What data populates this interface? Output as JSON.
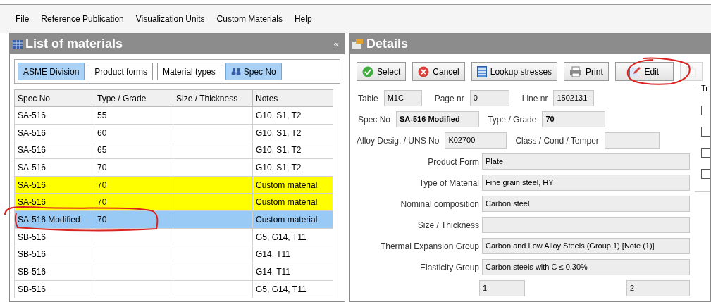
{
  "menu": [
    "File",
    "Reference Publication",
    "Visualization Units",
    "Custom Materials",
    "Help"
  ],
  "list_panel": {
    "title": "List of materials",
    "collapse": "«",
    "filters": [
      {
        "label": "ASME Division",
        "selected": true,
        "icon": false
      },
      {
        "label": "Product forms",
        "selected": false,
        "icon": false
      },
      {
        "label": "Material types",
        "selected": false,
        "icon": false
      },
      {
        "label": "Spec No",
        "selected": true,
        "icon": true
      }
    ],
    "columns": [
      "Spec No",
      "Type / Grade",
      "Size / Thickness",
      "Notes"
    ],
    "rows": [
      {
        "cells": [
          "SA-516",
          "55",
          "",
          "G10, S1, T2"
        ],
        "kind": "normal",
        "selected": false
      },
      {
        "cells": [
          "SA-516",
          "60",
          "",
          "G10, S1, T2"
        ],
        "kind": "normal",
        "selected": false
      },
      {
        "cells": [
          "SA-516",
          "65",
          "",
          "G10, S1, T2"
        ],
        "kind": "normal",
        "selected": false
      },
      {
        "cells": [
          "SA-516",
          "70",
          "",
          "G10, S1, T2"
        ],
        "kind": "normal",
        "selected": false
      },
      {
        "cells": [
          "SA-516",
          "70",
          "",
          "Custom material"
        ],
        "kind": "custom",
        "selected": false
      },
      {
        "cells": [
          "SA-516",
          "70",
          "",
          "Custom material"
        ],
        "kind": "custom",
        "selected": false
      },
      {
        "cells": [
          "SA-516 Modified",
          "70",
          "",
          "Custom material"
        ],
        "selected": true
      },
      {
        "cells": [
          "SB-516",
          "",
          "",
          "G5, G14, T11"
        ],
        "kind": "normal",
        "selected": false
      },
      {
        "cells": [
          "SB-516",
          "",
          "",
          "G14, T11"
        ],
        "kind": "normal",
        "selected": false
      },
      {
        "cells": [
          "SB-516",
          "",
          "",
          "G14, T11"
        ],
        "kind": "normal",
        "selected": false
      },
      {
        "cells": [
          "SB-516",
          "",
          "",
          "G5, G14, T11"
        ],
        "kind": "normal",
        "selected": false
      }
    ]
  },
  "details": {
    "title": "Details",
    "toolbar": [
      {
        "label": "Select",
        "kind": "select",
        "disabled": false
      },
      {
        "label": "Cancel",
        "kind": "cancel",
        "disabled": false
      },
      {
        "label": "Lookup stresses",
        "kind": "lookup",
        "disabled": false
      },
      {
        "label": "Print",
        "kind": "print",
        "disabled": false
      },
      {
        "label": "Edit",
        "kind": "edit",
        "disabled": false
      },
      {
        "kind": "copy",
        "disabled": true
      }
    ],
    "table": {
      "label": "Table",
      "value": "M1C"
    },
    "page_nr": {
      "label": "Page nr",
      "value": "0"
    },
    "line_nr": {
      "label": "Line nr",
      "value": "1502131"
    },
    "spec_no": {
      "label": "Spec No",
      "value": "SA-516 Modified"
    },
    "type_grade": {
      "label": "Type / Grade",
      "value": "70"
    },
    "alloy": {
      "label": "Alloy Desig. / UNS No",
      "value": "K02700"
    },
    "class_cond": {
      "label": "Class / Cond / Temper"
    },
    "wide_fields": [
      {
        "label": "Product Form",
        "value": "Plate"
      },
      {
        "label": "Type of Material",
        "value": "Fine grain steel, HY"
      },
      {
        "label": "Nominal composition",
        "value": "Carbon steel"
      },
      {
        "label": "Size / Thickness"
      },
      {
        "label": "Thermal Expansion Group",
        "value": "Carbon and Low Alloy Steels (Group 1) [Note (1)]"
      },
      {
        "label": "Elasticity Group",
        "value": "Carbon steels with C ≤ 0.30%"
      }
    ],
    "partial_fields": [
      "1",
      "2"
    ],
    "group": {
      "title": "Tr",
      "checkboxes": [
        {
          "checked": false
        },
        {
          "checked": false
        },
        {
          "checked": false
        },
        {
          "checked": false
        }
      ]
    }
  }
}
